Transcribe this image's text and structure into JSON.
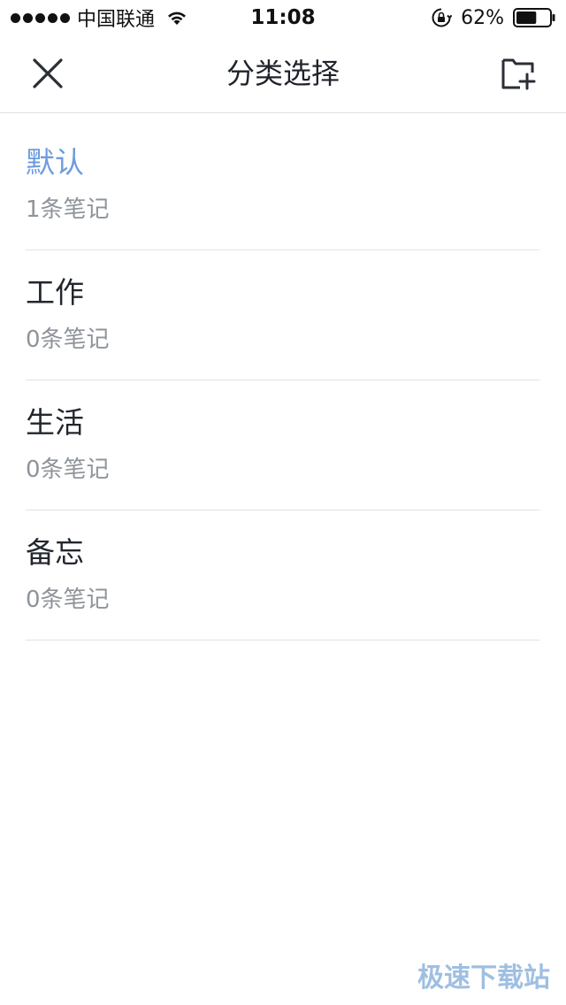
{
  "status_bar": {
    "carrier": "中国联通",
    "time": "11:08",
    "battery_percent": "62%",
    "battery_level": 0.62,
    "signal_bars": 5,
    "icons": [
      "signal-dots-icon",
      "wifi-icon",
      "orientation-lock-icon",
      "battery-icon"
    ]
  },
  "nav": {
    "title": "分类选择",
    "left_icon": "close-icon",
    "right_icon": "add-folder-icon"
  },
  "categories": [
    {
      "name": "默认",
      "count": "1条笔记",
      "selected": true
    },
    {
      "name": "工作",
      "count": "0条笔记",
      "selected": false
    },
    {
      "name": "生活",
      "count": "0条笔记",
      "selected": false
    },
    {
      "name": "备忘",
      "count": "0条笔记",
      "selected": false
    }
  ],
  "watermark": "极速下载站",
  "colors": {
    "selected_text": "#6d9be0",
    "title_text": "#1f232a",
    "secondary_text": "#8f949a",
    "divider": "#e3e3e3"
  }
}
